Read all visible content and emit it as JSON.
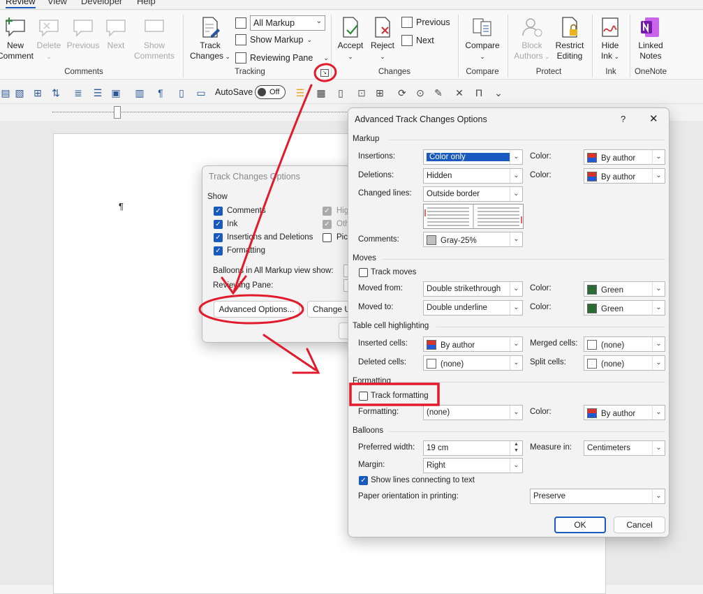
{
  "ribbon_tabs": [
    "Review",
    "View",
    "Developer",
    "Help"
  ],
  "comments_group": {
    "label": "Comments",
    "new_comment": "New\nComment",
    "delete": "Delete",
    "previous": "Previous",
    "next": "Next",
    "show_comments": "Show\nComments"
  },
  "tracking_group": {
    "label": "Tracking",
    "track_changes": "Track\nChanges",
    "markup_select": "All Markup",
    "show_markup": "Show Markup",
    "reviewing_pane": "Reviewing Pane"
  },
  "changes_group": {
    "label": "Changes",
    "accept": "Accept",
    "reject": "Reject",
    "previous": "Previous",
    "next": "Next"
  },
  "compare_group": {
    "label": "Compare",
    "compare": "Compare"
  },
  "protect_group": {
    "label": "Protect",
    "block_authors": "Block\nAuthors",
    "restrict_editing": "Restrict\nEditing"
  },
  "ink_group": {
    "label": "Ink",
    "hide_ink": "Hide\nInk"
  },
  "onenote_group": {
    "label": "OneNote",
    "linked_notes": "Linked\nNotes"
  },
  "qat": {
    "autosave_label": "AutoSave",
    "autosave_state": "Off"
  },
  "track_changes_dialog": {
    "title": "Track Changes Options",
    "show_label": "Show",
    "options": [
      {
        "label": "Comments",
        "checked": true
      },
      {
        "label": "Ink",
        "checked": true
      },
      {
        "label": "Insertions and Deletions",
        "checked": true
      },
      {
        "label": "Formatting",
        "checked": true
      }
    ],
    "right_options": [
      "Hig",
      "Oth",
      "Pict"
    ],
    "balloons_label": "Balloons in All Markup view show:",
    "reviewing_pane_label": "Reviewing Pane:",
    "advanced_button": "Advanced Options...",
    "change_button": "Change U"
  },
  "advanced_dialog": {
    "title": "Advanced Track Changes Options",
    "help": "?",
    "close": "✕",
    "markup": {
      "section": "Markup",
      "insertions_label": "Insertions:",
      "insertions_value": "Color only",
      "deletions_label": "Deletions:",
      "deletions_value": "Hidden",
      "changed_lines_label": "Changed lines:",
      "changed_lines_value": "Outside border",
      "comments_label": "Comments:",
      "comments_value": "Gray-25%",
      "color_label": "Color:",
      "insertions_color": "By author",
      "deletions_color": "By author"
    },
    "moves": {
      "section": "Moves",
      "track_moves": "Track moves",
      "moved_from_label": "Moved from:",
      "moved_from_value": "Double strikethrough",
      "moved_to_label": "Moved to:",
      "moved_to_value": "Double underline",
      "color_label": "Color:",
      "moved_from_color": "Green",
      "moved_to_color": "Green"
    },
    "table": {
      "section": "Table cell highlighting",
      "inserted_label": "Inserted cells:",
      "inserted_value": "By author",
      "deleted_label": "Deleted cells:",
      "deleted_value": "(none)",
      "merged_label": "Merged cells:",
      "merged_value": "(none)",
      "split_label": "Split cells:",
      "split_value": "(none)"
    },
    "formatting": {
      "section": "Formatting",
      "track_formatting": "Track formatting",
      "formatting_label": "Formatting:",
      "formatting_value": "(none)",
      "color_label": "Color:",
      "color_value": "By author"
    },
    "balloons": {
      "section": "Balloons",
      "width_label": "Preferred width:",
      "width_value": "19 cm",
      "measure_label": "Measure in:",
      "measure_value": "Centimeters",
      "margin_label": "Margin:",
      "margin_value": "Right",
      "show_lines": "Show lines connecting to text",
      "orientation_label": "Paper orientation in printing:",
      "orientation_value": "Preserve"
    },
    "ok": "OK",
    "cancel": "Cancel"
  },
  "colors": {
    "accent": "#185abd",
    "annotation": "#e21b2c",
    "author_red": "#d9342b",
    "author_blue": "#1f5bd6",
    "green": "#2e6b34",
    "gray25": "#bfbfbf"
  }
}
